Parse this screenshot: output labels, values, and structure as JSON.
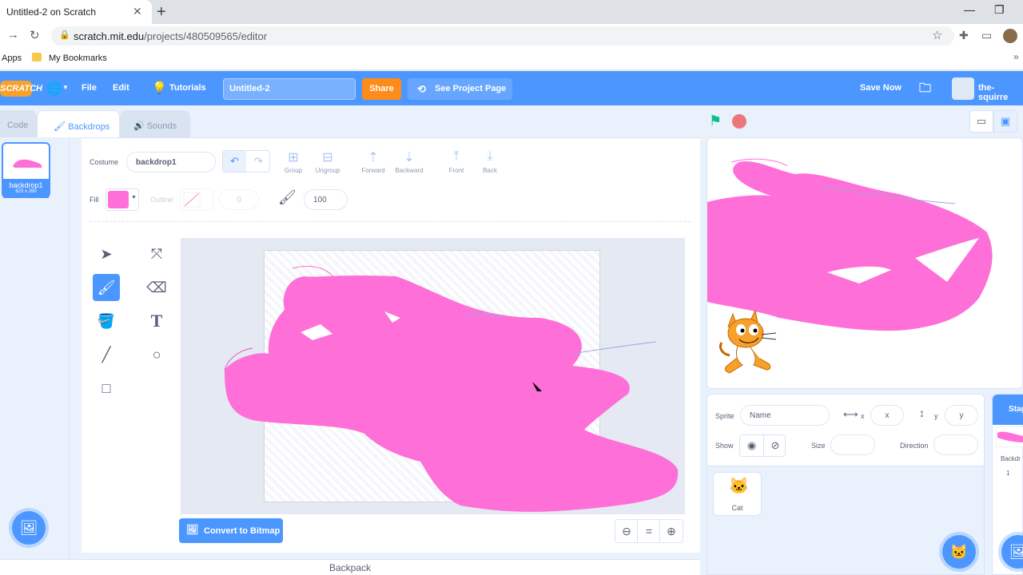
{
  "browser": {
    "tab_title": "Untitled-2 on Scratch",
    "url_host": "scratch.mit.edu",
    "url_path": "/projects/480509565/editor",
    "bookmarks": [
      "Apps",
      "My Bookmarks"
    ]
  },
  "menubar": {
    "logo": "SCRATCH",
    "file": "File",
    "edit": "Edit",
    "tutorials": "Tutorials",
    "project_title": "Untitled-2",
    "share": "Share",
    "see_project": "See Project Page",
    "save_now": "Save Now",
    "username": "the-squirre"
  },
  "tabs": {
    "code": "Code",
    "backdrops": "Backdrops",
    "sounds": "Sounds"
  },
  "costume_list": {
    "items": [
      {
        "name": "backdrop1",
        "size": "623 x 260"
      }
    ]
  },
  "paint": {
    "costume_label": "Costume",
    "costume_name": "backdrop1",
    "group": "Group",
    "ungroup": "Ungroup",
    "forward": "Forward",
    "backward": "Backward",
    "front": "Front",
    "back": "Back",
    "fill_label": "Fill",
    "fill_color": "#ff6fd8",
    "outline_label": "Outline",
    "outline_width": "0",
    "brush_size": "100",
    "convert": "Convert to Bitmap"
  },
  "sprite_info": {
    "sprite_label": "Sprite",
    "name_placeholder": "Name",
    "x_label": "x",
    "x_placeholder": "x",
    "y_label": "y",
    "y_placeholder": "y",
    "show_label": "Show",
    "size_label": "Size",
    "direction_label": "Direction"
  },
  "sprites": [
    {
      "name": "Cat"
    }
  ],
  "stage_panel": {
    "title": "Stag",
    "backdrops_label": "Backdr",
    "count": "1"
  },
  "backpack": "Backpack",
  "colors": {
    "accent": "#4c97ff",
    "share": "#ff8c1a",
    "paint": "#ff6fd8"
  }
}
